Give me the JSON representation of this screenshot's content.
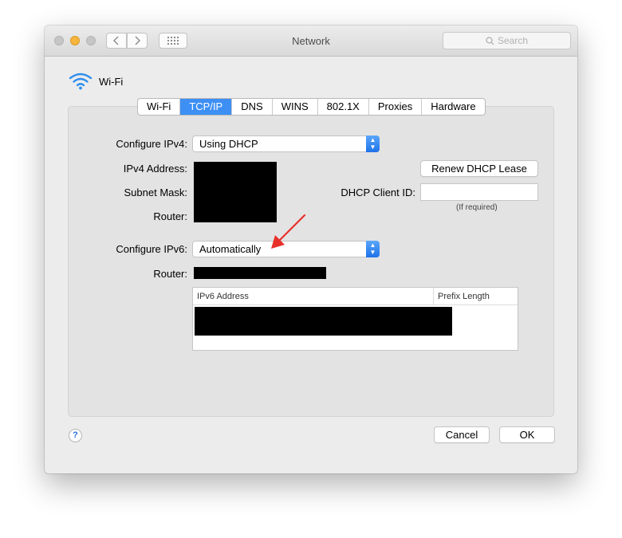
{
  "window": {
    "title": "Network",
    "search_placeholder": "Search",
    "traffic_lights": {
      "close": "#c1c1c1",
      "minimize": "#f6b53b",
      "zoom": "#c1c1c1"
    }
  },
  "interface": {
    "name": "Wi-Fi",
    "icon": "wifi-icon",
    "icon_color": "#2d8ef0"
  },
  "tabs": [
    {
      "label": "Wi-Fi",
      "active": false
    },
    {
      "label": "TCP/IP",
      "active": true
    },
    {
      "label": "DNS",
      "active": false
    },
    {
      "label": "WINS",
      "active": false
    },
    {
      "label": "802.1X",
      "active": false
    },
    {
      "label": "Proxies",
      "active": false
    },
    {
      "label": "Hardware",
      "active": false
    }
  ],
  "ipv4": {
    "configure_label": "Configure IPv4:",
    "configure_value": "Using DHCP",
    "address_label": "IPv4 Address:",
    "subnet_label": "Subnet Mask:",
    "router_label": "Router:"
  },
  "dhcp": {
    "renew_label": "Renew DHCP Lease",
    "client_id_label": "DHCP Client ID:",
    "client_id_value": "",
    "client_id_hint": "(If required)"
  },
  "ipv6": {
    "configure_label": "Configure IPv6:",
    "configure_value": "Automatically",
    "router_label": "Router:",
    "table": {
      "col_address": "IPv6 Address",
      "col_prefix": "Prefix Length"
    }
  },
  "footer": {
    "help": "?",
    "cancel_label": "Cancel",
    "ok_label": "OK"
  },
  "annotation_color": "#e8302a",
  "accent_color": "#3d8ff4"
}
